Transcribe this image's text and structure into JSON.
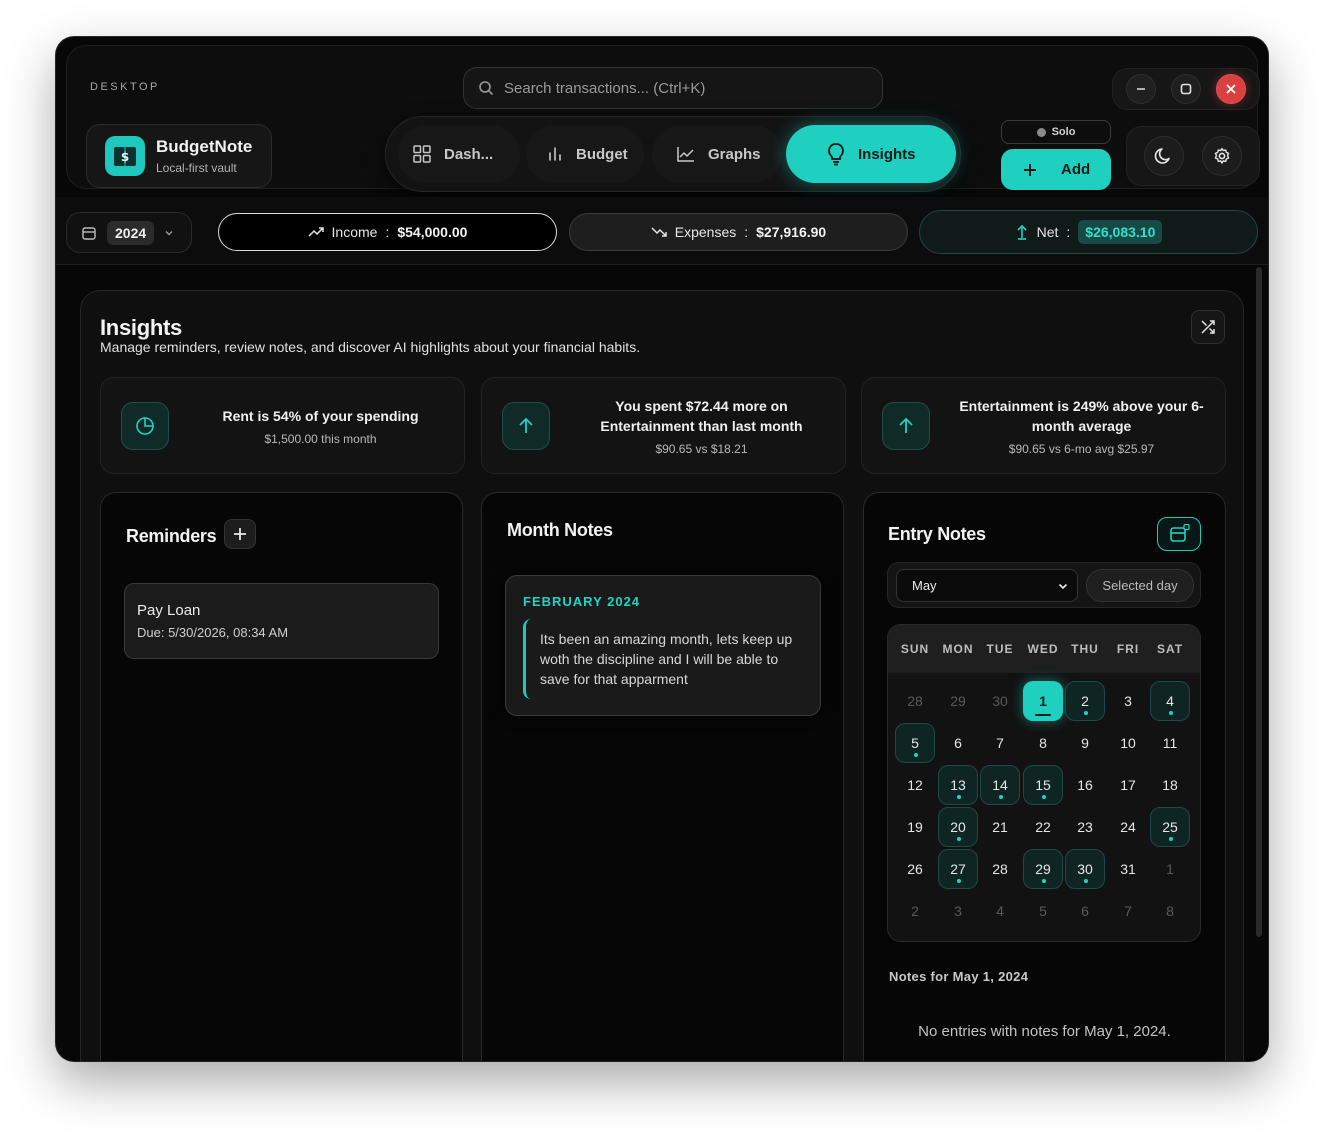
{
  "window": {
    "label": "DESKTOP",
    "search_placeholder": "Search transactions... (Ctrl+K)"
  },
  "brand": {
    "name": "BudgetNote",
    "subtitle": "Local-first vault"
  },
  "nav": {
    "items": [
      {
        "label": "Dash...",
        "icon": "grid-icon"
      },
      {
        "label": "Budget",
        "icon": "bars-icon"
      },
      {
        "label": "Graphs",
        "icon": "line-chart-icon"
      },
      {
        "label": "Insights",
        "icon": "lightbulb-icon",
        "active": true
      }
    ]
  },
  "mode_badge": "Solo",
  "add_label": "Add",
  "summary": {
    "year": "2024",
    "income_label": "Income",
    "income_value": "$54,000.00",
    "expenses_label": "Expenses",
    "expenses_value": "$27,916.90",
    "net_label": "Net",
    "net_value": "$26,083.10"
  },
  "insights": {
    "title": "Insights",
    "subtitle": "Manage reminders, review notes, and discover AI highlights about your financial habits.",
    "cards": [
      {
        "headline": "Rent is 54% of your spending",
        "detail": "$1,500.00 this month",
        "icon": "pie-chart-icon"
      },
      {
        "headline": "You spent $72.44 more on Entertainment than last month",
        "detail": "$90.65 vs $18.21",
        "icon": "arrow-up-icon"
      },
      {
        "headline": "Entertainment is 249% above your 6-month average",
        "detail": "$90.65 vs 6-mo avg $25.97",
        "icon": "arrow-up-icon"
      }
    ]
  },
  "reminders": {
    "title": "Reminders",
    "items": [
      {
        "title": "Pay Loan",
        "due": "Due: 5/30/2026, 08:34 AM"
      }
    ]
  },
  "month_notes": {
    "title": "Month Notes",
    "items": [
      {
        "month": "FEBRUARY 2024",
        "text": "Its been an amazing month, lets keep up woth the discipline and I will be able to save for that apparment"
      }
    ]
  },
  "entry_notes": {
    "title": "Entry Notes",
    "month_select": "May",
    "selected_day_label": "Selected day",
    "weekdays": [
      "SUN",
      "MON",
      "TUE",
      "WED",
      "THU",
      "FRI",
      "SAT"
    ],
    "days": [
      [
        "28",
        "29",
        "30",
        "1",
        "2",
        "3",
        "4"
      ],
      [
        "5",
        "6",
        "7",
        "8",
        "9",
        "10",
        "11"
      ],
      [
        "12",
        "13",
        "14",
        "15",
        "16",
        "17",
        "18"
      ],
      [
        "19",
        "20",
        "21",
        "22",
        "23",
        "24",
        "25"
      ],
      [
        "26",
        "27",
        "28",
        "29",
        "30",
        "31",
        "1"
      ],
      [
        "2",
        "3",
        "4",
        "5",
        "6",
        "7",
        "8"
      ]
    ],
    "selected_date": "1",
    "days_with_notes": [
      "2",
      "4",
      "5",
      "13",
      "14",
      "15",
      "20",
      "25",
      "27",
      "29",
      "30"
    ],
    "notes_for": "Notes for May 1, 2024",
    "empty_text": "No entries with notes for May 1, 2024."
  },
  "colors": {
    "accent": "#1fcfc0",
    "close": "#d94141",
    "background": "#070707"
  }
}
